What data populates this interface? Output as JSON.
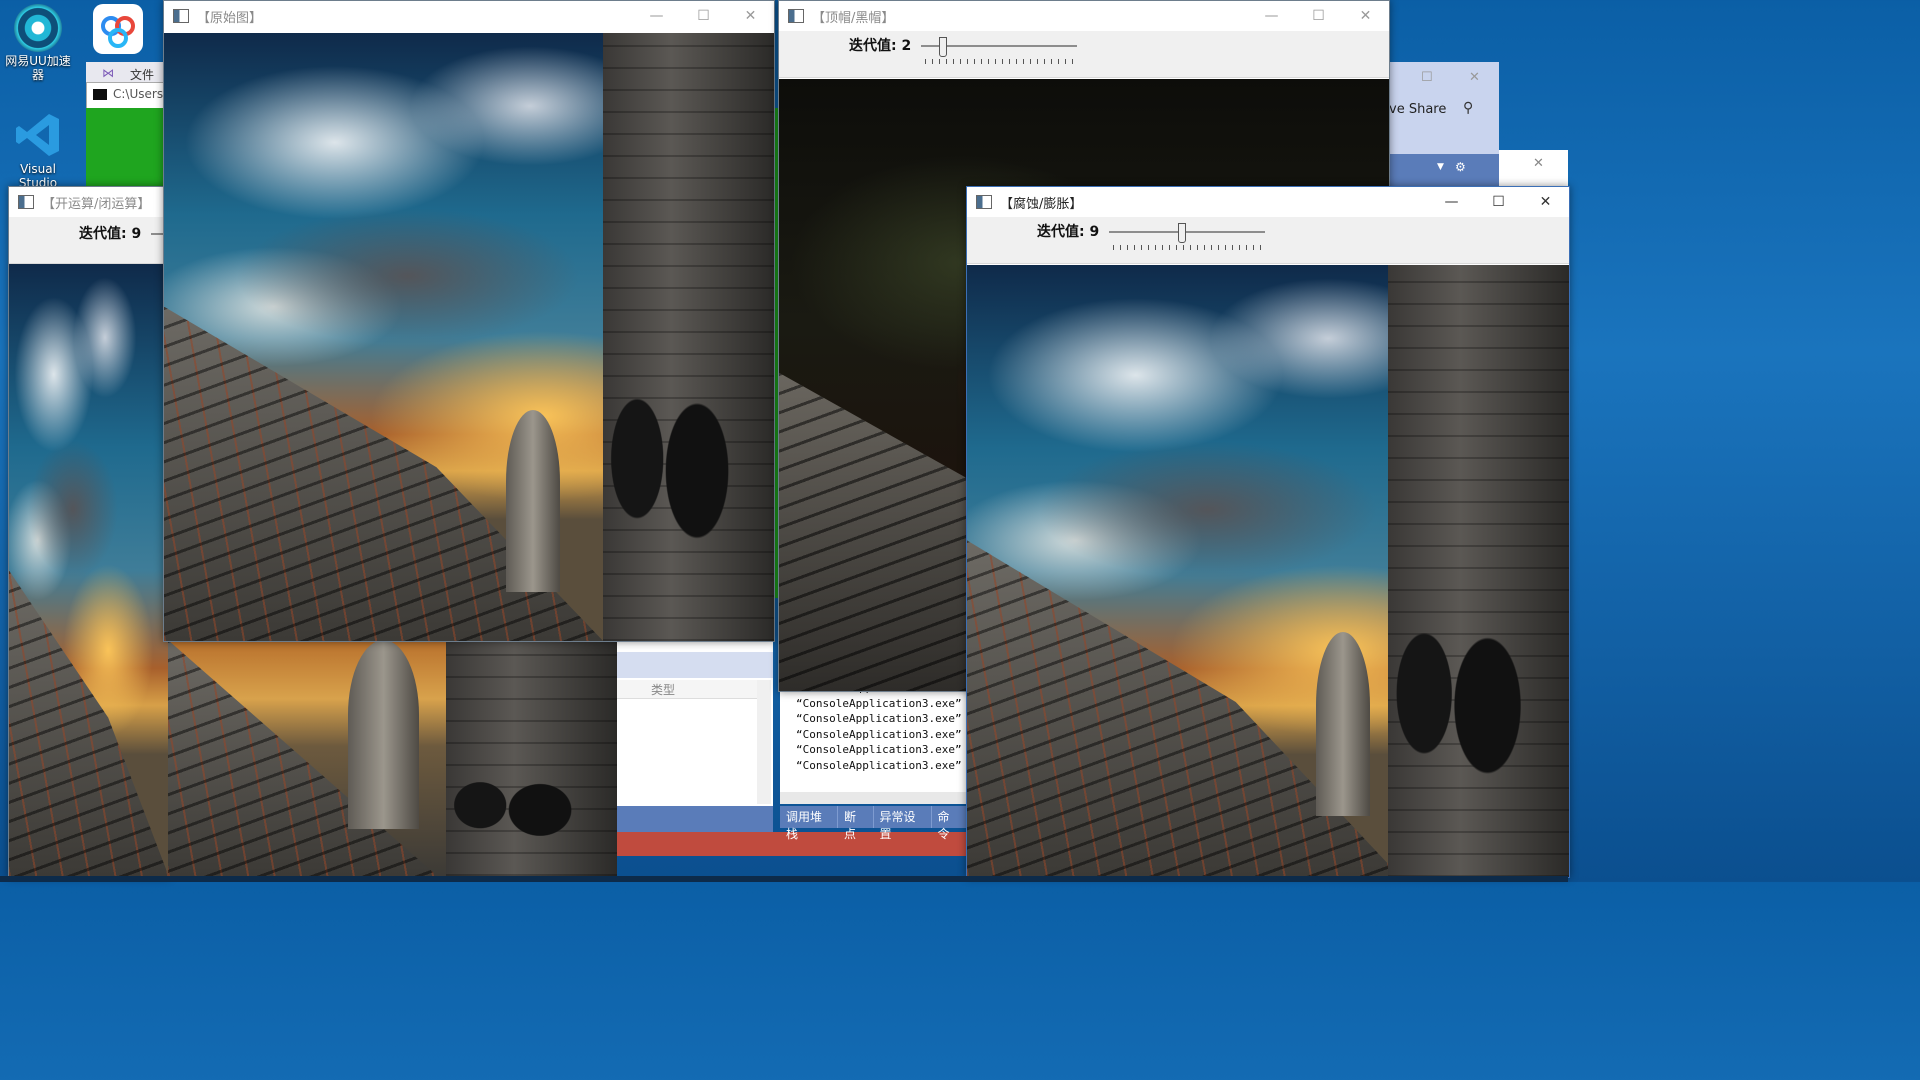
{
  "desktop": {
    "icons": [
      {
        "label": "网易UU加速器"
      },
      {
        "label": "Visual Studio Code"
      }
    ]
  },
  "background_windows": {
    "cmd_title": "C:\\Users",
    "file_tab": "文件",
    "liveshare_label": "ve Share",
    "vs_column_header": "类型",
    "debug_tabs": [
      "调用堆栈",
      "断点",
      "异常设置",
      "命令"
    ],
    "console_lines": [
      "ConsoleApplication3.exe",
      "“ConsoleApplication3.exe”",
      "“ConsoleApplication3.exe”",
      "“ConsoleApplication3.exe”",
      "“ConsoleApplication3.exe”",
      "“ConsoleApplication3.exe”",
      "“ConsoleApplication3.exe”"
    ]
  },
  "windows": {
    "original": {
      "title": "【原始图】"
    },
    "tophat": {
      "title": "【顶帽/黑帽】",
      "iter_label": "迭代值: 2",
      "slider_value": 2
    },
    "openclose": {
      "title": "【开运算/闭运算】",
      "iter_label": "迭代值: 9",
      "slider_value": 9
    },
    "erode": {
      "title": "【腐蚀/膨胀】",
      "iter_label": "迭代值: 9",
      "slider_value": 9
    }
  },
  "caption_buttons": {
    "minimize": "—",
    "maximize": "☐",
    "close": "✕"
  },
  "colors": {
    "accent_green": "#1fa51f",
    "vs_blue": "#5a7cb9",
    "liveshare_panel": "#c9d4ee"
  }
}
